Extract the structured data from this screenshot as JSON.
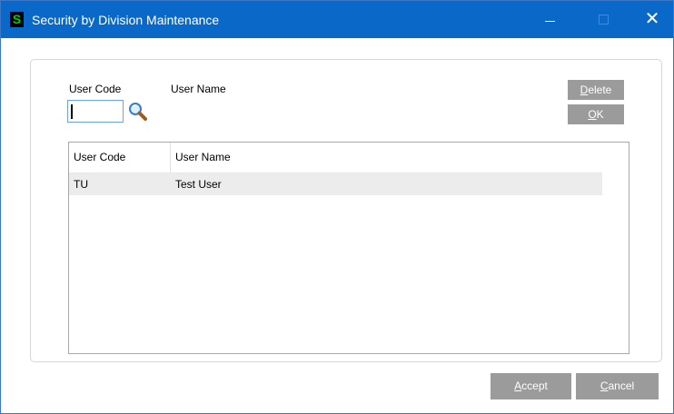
{
  "window": {
    "title": "Security by Division Maintenance",
    "app_icon_letter": "S",
    "minimize_icon": "minimize-icon",
    "maximize_icon": "maximize-icon",
    "close_icon": "close-icon",
    "close_glyph": "✕"
  },
  "form": {
    "user_code_label": "User Code",
    "user_name_label": "User Name",
    "user_code_value": "",
    "lookup_icon": "magnifier-icon"
  },
  "buttons": {
    "delete_first": "D",
    "delete_rest": "elete",
    "ok_first": "O",
    "ok_rest": "K",
    "accept_first": "A",
    "accept_rest": "ccept",
    "cancel_first": "C",
    "cancel_rest": "ancel"
  },
  "grid": {
    "columns": [
      "User Code",
      "User Name"
    ],
    "rows": [
      {
        "code": "TU",
        "name": "Test User"
      }
    ]
  },
  "colors": {
    "titlebar": "#0a68c8",
    "button_gray": "#9b9b9b",
    "selected_row": "#ececec"
  }
}
